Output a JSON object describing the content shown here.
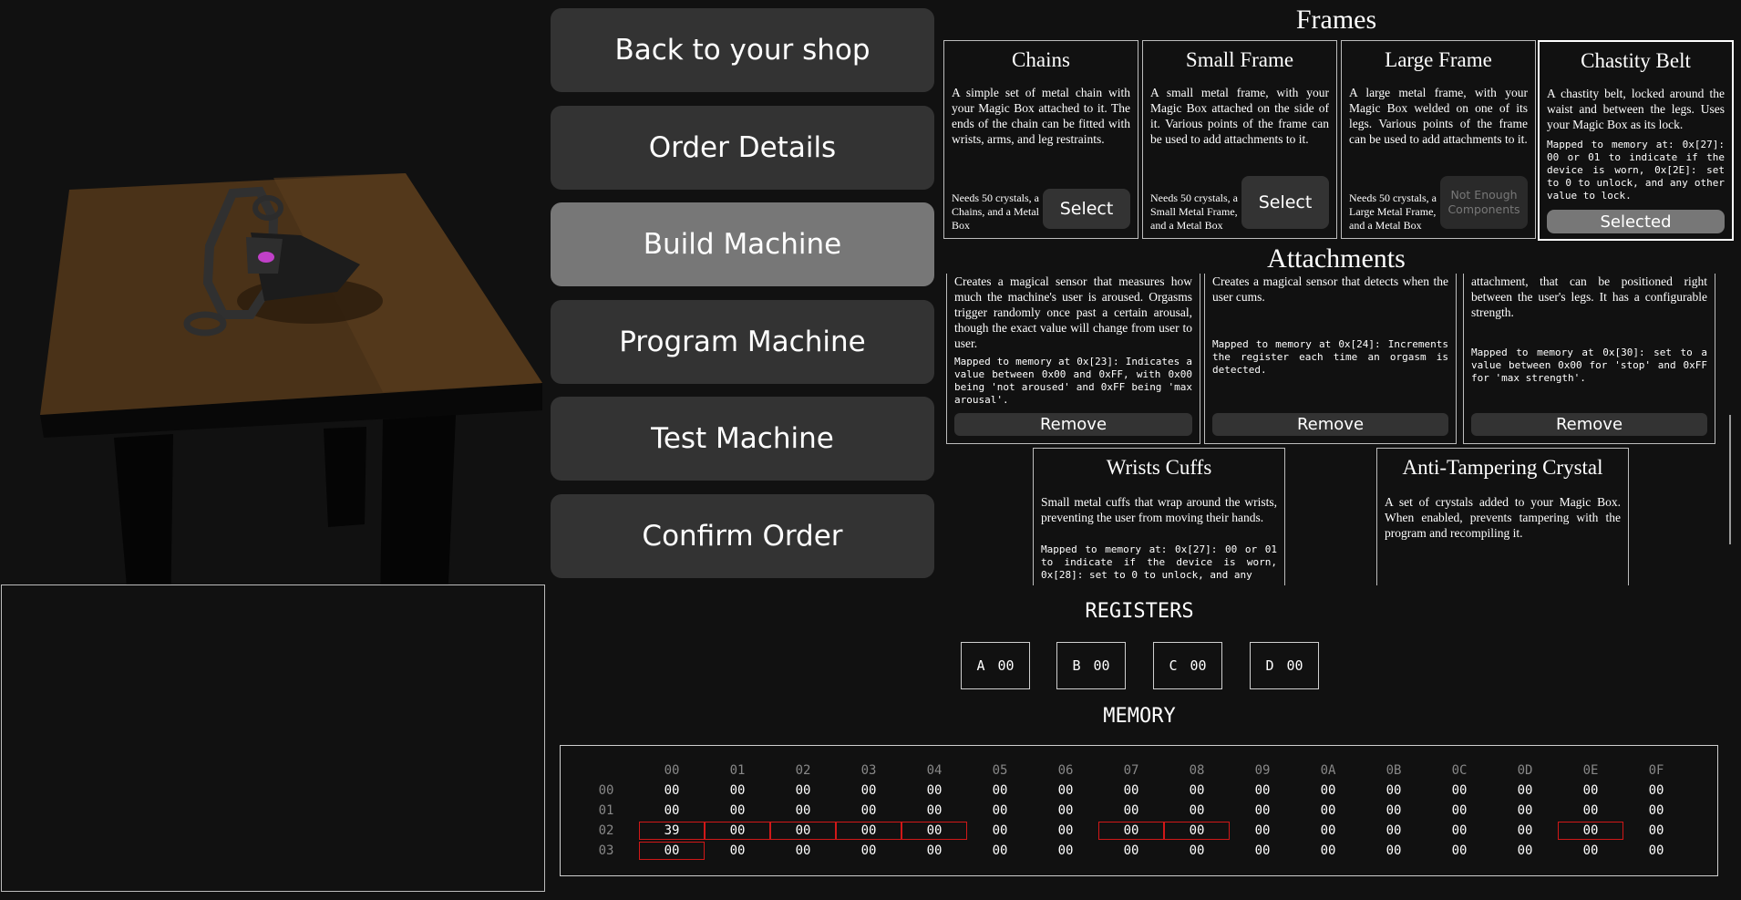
{
  "nav": {
    "back": "Back to your shop",
    "order_details": "Order Details",
    "build": "Build Machine",
    "program": "Program Machine",
    "test": "Test Machine",
    "confirm": "Confirm Order"
  },
  "frames": {
    "title": "Frames",
    "items": [
      {
        "title": "Chains",
        "desc": "A simple set of metal chain with your Magic Box attached to it. The ends of the chain can be fitted with wrists, arms, and leg restraints.",
        "needs": "Needs 50 crystals, a Chains, and a Metal Box",
        "button": "Select"
      },
      {
        "title": "Small Frame",
        "desc": "A small metal frame, with your Magic Box attached on the side of it. Various points of the frame can be used to add attachments to it.",
        "needs": "Needs 50 crystals, a Small Metal Frame, and a Metal Box",
        "button": "Select"
      },
      {
        "title": "Large Frame",
        "desc": "A large metal frame, with your Magic Box welded on one of its legs. Various points of the frame can be used to add attachments to it.",
        "needs": "Needs 50 crystals, a Large Metal Frame, and a Metal Box",
        "button": "Not Enough Components"
      },
      {
        "title": "Chastity Belt",
        "desc": "A chastity belt, locked around the waist and between the legs. Uses your Magic Box as its lock.",
        "memory": "Mapped to memory at: 0x[27]: 00 or 01 to indicate if the device is worn, 0x[2E]: set to 0 to unlock, and any other value to lock.",
        "button": "Selected"
      }
    ]
  },
  "attachments": {
    "title": "Attachments",
    "row1": [
      {
        "desc": "Creates a magical sensor that measures how much the machine's user is aroused. Orgasms trigger randomly once past a certain arousal, though the exact value will change from user to user.",
        "memory": "Mapped to memory at 0x[23]: Indicates a value between 0x00 and 0xFF, with 0x00 being 'not aroused' and 0xFF being 'max arousal'.",
        "button": "Remove"
      },
      {
        "desc": "Creates a magical sensor that detects when the user cums.",
        "memory": "Mapped to memory at 0x[24]: Increments the register each time an orgasm is detected.",
        "button": "Remove"
      },
      {
        "desc": "attachment, that can be positioned right between the user's legs. It has a configurable strength.",
        "memory": "Mapped to memory at 0x[30]: set to a value between 0x00 for 'stop' and 0xFF for 'max strength'.",
        "button": "Remove"
      }
    ],
    "row2": [
      {
        "title": "Wrists Cuffs",
        "desc": "Small metal cuffs that wrap around the wrists, preventing the user from moving their hands.",
        "memory": "Mapped to memory at: 0x[27]: 00 or 01 to indicate if the device is worn, 0x[28]: set to 0 to unlock, and any"
      },
      {
        "title": "Anti-Tampering Crystal",
        "desc": "A set of crystals added to your Magic Box. When enabled, prevents tampering with the program and recompiling it."
      }
    ]
  },
  "registers": {
    "title": "REGISTERS",
    "items": [
      {
        "name": "A",
        "value": "00"
      },
      {
        "name": "B",
        "value": "00"
      },
      {
        "name": "C",
        "value": "00"
      },
      {
        "name": "D",
        "value": "00"
      }
    ]
  },
  "memory": {
    "title": "MEMORY",
    "col_headers": [
      "00",
      "01",
      "02",
      "03",
      "04",
      "05",
      "06",
      "07",
      "08",
      "09",
      "0A",
      "0B",
      "0C",
      "0D",
      "0E",
      "0F"
    ],
    "row_headers": [
      "00",
      "01",
      "02",
      "03"
    ],
    "rows": [
      [
        "00",
        "00",
        "00",
        "00",
        "00",
        "00",
        "00",
        "00",
        "00",
        "00",
        "00",
        "00",
        "00",
        "00",
        "00",
        "00"
      ],
      [
        "00",
        "00",
        "00",
        "00",
        "00",
        "00",
        "00",
        "00",
        "00",
        "00",
        "00",
        "00",
        "00",
        "00",
        "00",
        "00"
      ],
      [
        "39",
        "00",
        "00",
        "00",
        "00",
        "00",
        "00",
        "00",
        "00",
        "00",
        "00",
        "00",
        "00",
        "00",
        "00",
        "00"
      ],
      [
        "00",
        "00",
        "00",
        "00",
        "00",
        "00",
        "00",
        "00",
        "00",
        "00",
        "00",
        "00",
        "00",
        "00",
        "00",
        "00"
      ]
    ],
    "highlighted": [
      [
        2,
        0
      ],
      [
        2,
        1
      ],
      [
        2,
        2
      ],
      [
        2,
        3
      ],
      [
        2,
        4
      ],
      [
        2,
        7
      ],
      [
        2,
        8
      ],
      [
        2,
        14
      ],
      [
        3,
        0
      ]
    ],
    "highlight_color": "#d01818"
  },
  "colors": {
    "background": "#111111",
    "button": "#333333",
    "button_active": "#777777",
    "table_top": "#4a3218",
    "table_legs": "#060606"
  }
}
